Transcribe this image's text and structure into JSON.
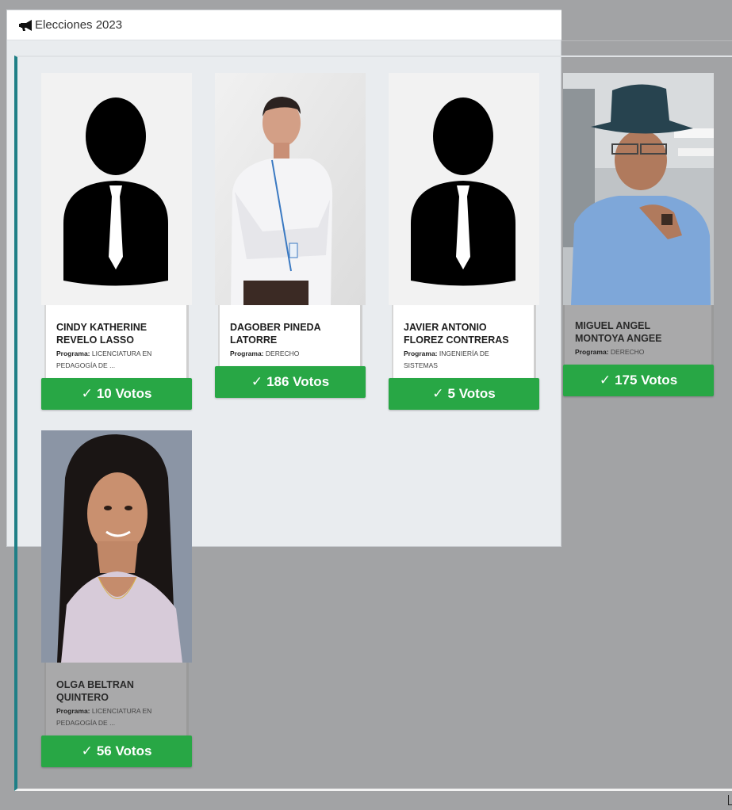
{
  "header": {
    "title": "Elecciones 2023",
    "icon": "megaphone-icon"
  },
  "program_label": "Programa:",
  "vote_suffix": "Votos",
  "candidates": [
    {
      "name": "CINDY KATHERINE REVELO LASSO",
      "program": "LICENCIATURA EN PEDAGOGÍA DE ...",
      "votes": "10 Votos",
      "photo": "placeholder-silhouette"
    },
    {
      "name": "DAGOBER PINEDA LATORRE",
      "program": "DERECHO",
      "votes": "186 Votos",
      "photo": "man-white-shirt"
    },
    {
      "name": "JAVIER ANTONIO FLOREZ CONTRERAS",
      "program": "INGENIERÍA DE SISTEMAS",
      "votes": "5 Votos",
      "photo": "placeholder-silhouette"
    },
    {
      "name": "MIGUEL ANGEL MONTOYA ANGEE",
      "program": "DERECHO",
      "votes": "175 Votos",
      "photo": "man-hat"
    },
    {
      "name": "OLGA BELTRAN QUINTERO",
      "program": "LICENCIATURA EN PEDAGOGÍA DE ...",
      "votes": "56 Votos",
      "photo": "woman-portrait"
    }
  ],
  "colors": {
    "accent": "#28a745",
    "frame": "#1f7f86",
    "overlay": "#a2a3a5"
  }
}
